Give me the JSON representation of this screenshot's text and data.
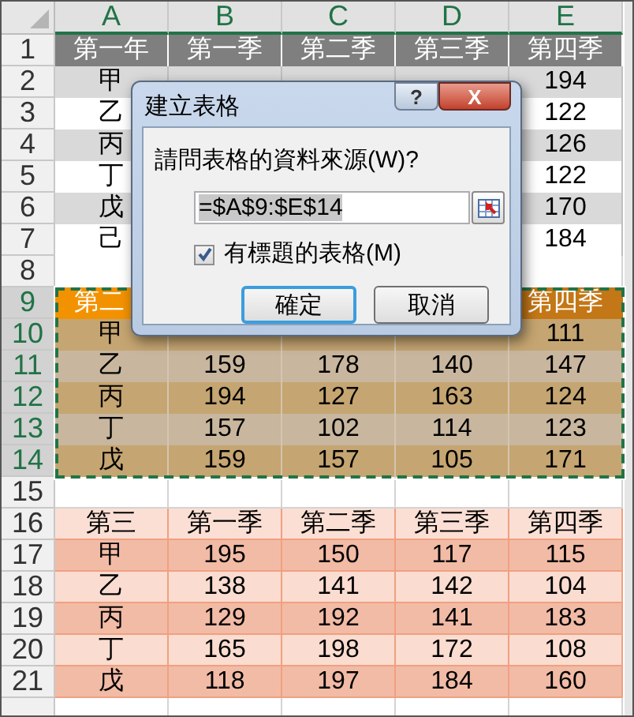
{
  "column_headers": [
    {
      "label": "A",
      "selected": true
    },
    {
      "label": "B",
      "selected": true
    },
    {
      "label": "C",
      "selected": true
    },
    {
      "label": "D",
      "selected": true
    },
    {
      "label": "E",
      "selected": true
    }
  ],
  "rows": [
    {
      "number": "1",
      "kind": "gray-header",
      "selected": false,
      "cells": [
        "第一年",
        "第一季",
        "第二季",
        "第三季",
        "第四季"
      ]
    },
    {
      "number": "2",
      "kind": "gray-band",
      "selected": false,
      "cells": [
        "甲",
        null,
        null,
        null,
        "194"
      ]
    },
    {
      "number": "3",
      "kind": "gray-plain",
      "selected": false,
      "cells": [
        "乙",
        null,
        null,
        null,
        "122"
      ]
    },
    {
      "number": "4",
      "kind": "gray-band",
      "selected": false,
      "cells": [
        "丙",
        null,
        null,
        null,
        "126"
      ]
    },
    {
      "number": "5",
      "kind": "gray-plain",
      "selected": false,
      "cells": [
        "丁",
        null,
        null,
        null,
        "122"
      ]
    },
    {
      "number": "6",
      "kind": "gray-band",
      "selected": false,
      "cells": [
        "戊",
        null,
        null,
        null,
        "170"
      ]
    },
    {
      "number": "7",
      "kind": "gray-plain",
      "selected": false,
      "cells": [
        "己",
        null,
        null,
        null,
        "184"
      ]
    },
    {
      "number": "8",
      "kind": "blank",
      "selected": false,
      "cells": [
        null,
        null,
        null,
        null,
        null
      ]
    },
    {
      "number": "9",
      "kind": "orange-header",
      "selected": true,
      "holds_active_cell": true,
      "cells": [
        "第二",
        null,
        null,
        null,
        "第四季"
      ]
    },
    {
      "number": "10",
      "kind": "orange-band",
      "selected": true,
      "cells": [
        "甲",
        null,
        null,
        null,
        "111"
      ]
    },
    {
      "number": "11",
      "kind": "orange-plain",
      "selected": true,
      "cells": [
        "乙",
        "159",
        "178",
        "140",
        "147"
      ]
    },
    {
      "number": "12",
      "kind": "orange-band",
      "selected": true,
      "cells": [
        "丙",
        "194",
        "127",
        "163",
        "124"
      ]
    },
    {
      "number": "13",
      "kind": "orange-plain",
      "selected": true,
      "cells": [
        "丁",
        "157",
        "102",
        "114",
        "123"
      ]
    },
    {
      "number": "14",
      "kind": "orange-band",
      "selected": true,
      "cells": [
        "戊",
        "159",
        "157",
        "105",
        "171"
      ]
    },
    {
      "number": "15",
      "kind": "blank",
      "selected": false,
      "cells": [
        null,
        null,
        null,
        null,
        null
      ]
    },
    {
      "number": "16",
      "kind": "salmon-header",
      "selected": false,
      "cells": [
        "第三",
        "第一季",
        "第二季",
        "第三季",
        "第四季"
      ]
    },
    {
      "number": "17",
      "kind": "salmon-band",
      "selected": false,
      "cells": [
        "甲",
        "195",
        "150",
        "117",
        "115"
      ]
    },
    {
      "number": "18",
      "kind": "salmon-plain",
      "selected": false,
      "cells": [
        "乙",
        "138",
        "141",
        "142",
        "104"
      ]
    },
    {
      "number": "19",
      "kind": "salmon-band",
      "selected": false,
      "cells": [
        "丙",
        "129",
        "192",
        "141",
        "183"
      ]
    },
    {
      "number": "20",
      "kind": "salmon-plain",
      "selected": false,
      "cells": [
        "丁",
        "165",
        "198",
        "172",
        "108"
      ]
    },
    {
      "number": "21",
      "kind": "salmon-band",
      "selected": false,
      "cells": [
        "戊",
        "118",
        "197",
        "184",
        "160"
      ]
    }
  ],
  "dialog": {
    "title": "建立表格",
    "help_button": "?",
    "close_button": "X",
    "prompt": "請問表格的資料來源(W)?",
    "range_value": "=$A$9:$E$14",
    "checkbox": {
      "label": "有標題的表格(M)",
      "checked": true
    },
    "buttons": [
      {
        "label": "確定",
        "selected": true
      },
      {
        "label": "取消",
        "selected": false
      }
    ]
  }
}
